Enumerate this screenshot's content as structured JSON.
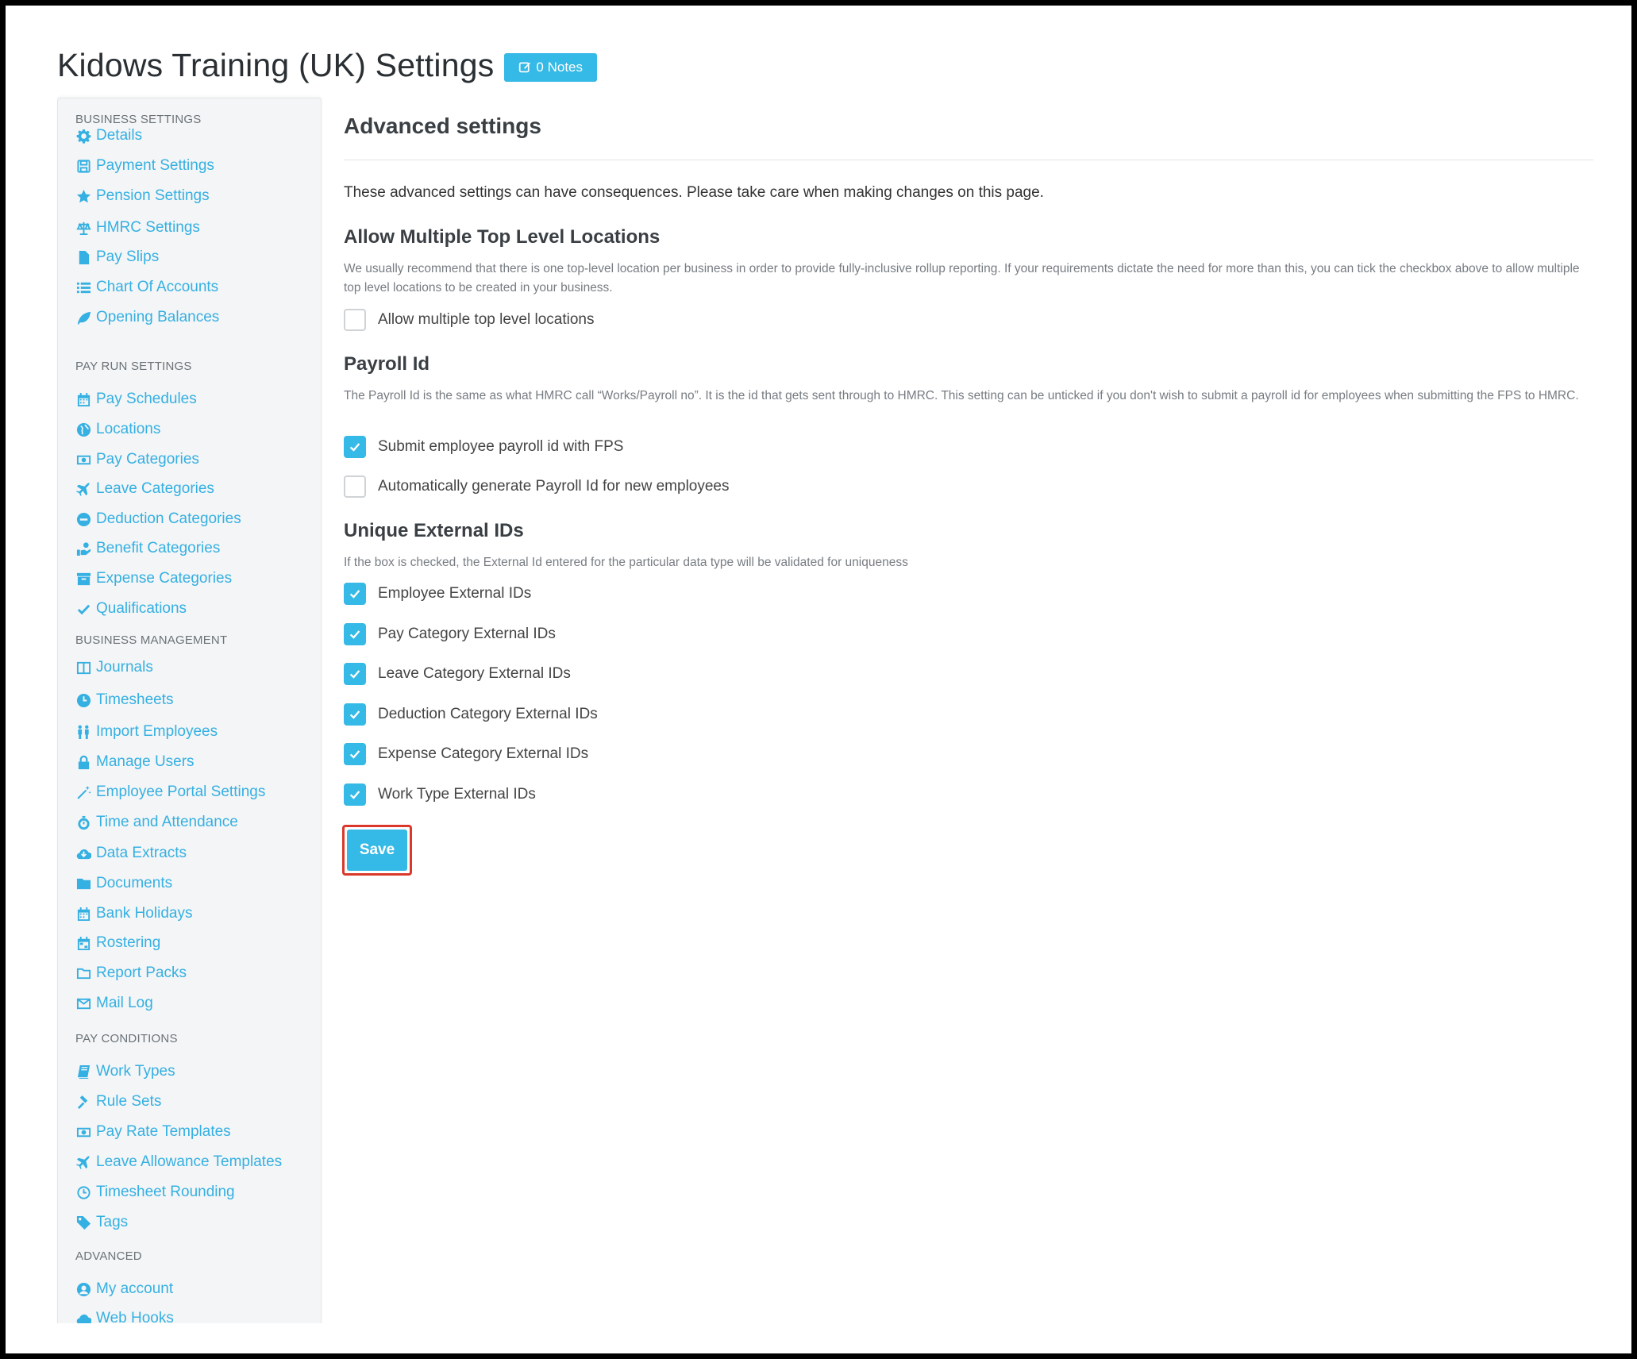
{
  "header": {
    "title": "Kidows Training (UK) Settings",
    "notes_label": "0 Notes"
  },
  "sidebar": {
    "sections": [
      {
        "title": "BUSINESS SETTINGS",
        "items": [
          {
            "label": "Details",
            "icon": "gear-icon"
          },
          {
            "label": "Payment Settings",
            "icon": "save-icon"
          },
          {
            "label": "Pension Settings",
            "icon": "star-icon"
          },
          {
            "label": "HMRC Settings",
            "icon": "scale-icon"
          },
          {
            "label": "Pay Slips",
            "icon": "file-icon"
          },
          {
            "label": "Chart Of Accounts",
            "icon": "list-icon"
          },
          {
            "label": "Opening Balances",
            "icon": "leaf-icon"
          }
        ]
      },
      {
        "title": "PAY RUN SETTINGS",
        "items": [
          {
            "label": "Pay Schedules",
            "icon": "calendar-icon"
          },
          {
            "label": "Locations",
            "icon": "globe-icon"
          },
          {
            "label": "Pay Categories",
            "icon": "money-icon"
          },
          {
            "label": "Leave Categories",
            "icon": "plane-icon"
          },
          {
            "label": "Deduction Categories",
            "icon": "minus-circle-icon"
          },
          {
            "label": "Benefit Categories",
            "icon": "hand-icon"
          },
          {
            "label": "Expense Categories",
            "icon": "archive-icon"
          },
          {
            "label": "Qualifications",
            "icon": "check-icon"
          }
        ]
      },
      {
        "title": "BUSINESS MANAGEMENT",
        "items": [
          {
            "label": "Journals",
            "icon": "columns-icon"
          },
          {
            "label": "Timesheets",
            "icon": "clock-icon"
          },
          {
            "label": "Import Employees",
            "icon": "users-icon"
          },
          {
            "label": "Manage Users",
            "icon": "lock-icon"
          },
          {
            "label": "Employee Portal Settings",
            "icon": "wand-icon"
          },
          {
            "label": "Time and Attendance",
            "icon": "stopwatch-icon"
          },
          {
            "label": "Data Extracts",
            "icon": "cloud-download-icon"
          },
          {
            "label": "Documents",
            "icon": "folder-icon"
          },
          {
            "label": "Bank Holidays",
            "icon": "calendar-icon"
          },
          {
            "label": "Rostering",
            "icon": "calendar-grid-icon"
          },
          {
            "label": "Report Packs",
            "icon": "folder-outline-icon"
          },
          {
            "label": "Mail Log",
            "icon": "envelope-icon"
          }
        ]
      },
      {
        "title": "PAY CONDITIONS",
        "items": [
          {
            "label": "Work Types",
            "icon": "book-icon"
          },
          {
            "label": "Rule Sets",
            "icon": "gavel-icon"
          },
          {
            "label": "Pay Rate Templates",
            "icon": "money-icon"
          },
          {
            "label": "Leave Allowance Templates",
            "icon": "plane-icon"
          },
          {
            "label": "Timesheet Rounding",
            "icon": "clock-outline-icon"
          },
          {
            "label": "Tags",
            "icon": "tag-icon"
          }
        ]
      },
      {
        "title": "ADVANCED",
        "items": [
          {
            "label": "My account",
            "icon": "user-circle-icon"
          },
          {
            "label": "Web Hooks",
            "icon": "cloud-icon"
          }
        ]
      }
    ]
  },
  "main": {
    "title": "Advanced settings",
    "intro": "These advanced settings can have consequences. Please take care when making changes on this page.",
    "multi_location": {
      "heading": "Allow Multiple Top Level Locations",
      "description": "We usually recommend that there is one top-level location per business in order to provide fully-inclusive rollup reporting. If your requirements dictate the need for more than this, you can tick the checkbox above to allow multiple top level locations to be created in your business.",
      "checkbox_label": "Allow multiple top level locations",
      "checked": false
    },
    "payroll_id": {
      "heading": "Payroll Id",
      "description": "The Payroll Id is the same as what HMRC call “Works/Payroll no”. It is the id that gets sent through to HMRC. This setting can be unticked if you don't wish to submit a payroll id for employees when submitting the FPS to HMRC.",
      "options": [
        {
          "label": "Submit employee payroll id with FPS",
          "checked": true
        },
        {
          "label": "Automatically generate Payroll Id for new employees",
          "checked": false
        }
      ]
    },
    "unique_ids": {
      "heading": "Unique External IDs",
      "description": "If the box is checked, the External Id entered for the particular data type will be validated for uniqueness",
      "options": [
        {
          "label": "Employee External IDs",
          "checked": true
        },
        {
          "label": "Pay Category External IDs",
          "checked": true
        },
        {
          "label": "Leave Category External IDs",
          "checked": true
        },
        {
          "label": "Deduction Category External IDs",
          "checked": true
        },
        {
          "label": "Expense Category External IDs",
          "checked": true
        },
        {
          "label": "Work Type External IDs",
          "checked": true
        }
      ]
    },
    "save_label": "Save"
  },
  "colors": {
    "accent": "#35b9e6",
    "highlight": "#d9382b"
  }
}
